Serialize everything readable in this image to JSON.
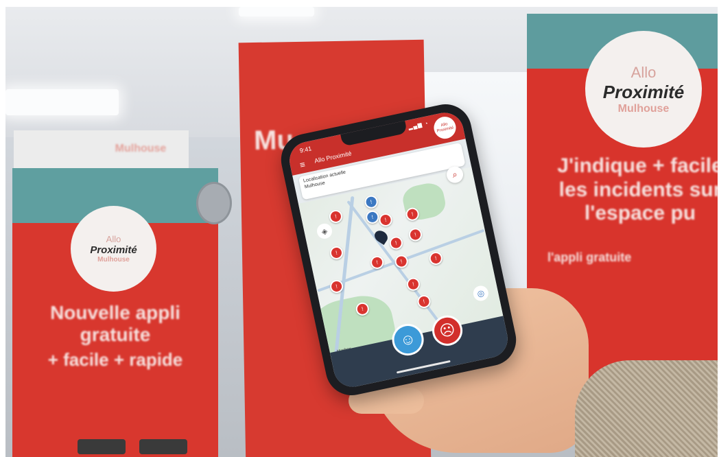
{
  "banners": {
    "right": {
      "logo_line1": "Allo",
      "logo_line2": "Proximité",
      "logo_line3": "Mulhouse",
      "headline": "J'indique + facile les incidents sur l'espace pu",
      "subtext": "l'appli gratuite"
    },
    "left": {
      "logo_line1": "Allo",
      "logo_line2": "Proximité",
      "logo_line3": "Mulhouse",
      "headline": "Nouvelle appli gratuite",
      "tagline": "+ facile + rapide",
      "top_text": "Mulhouse"
    },
    "middle": {
      "headline": "Mu"
    }
  },
  "phone": {
    "status_time": "9:41",
    "status_icons": "▂▄▆ ◔",
    "menu_icon": "hamburger-icon",
    "app_title": "Allo Proximité",
    "logo_badge": "Allo Proximité",
    "address": {
      "line1": "Localisation actuelle",
      "line2": "Mulhouse"
    },
    "map_attribution": "Mapbox",
    "colors": {
      "header": "#c8302b",
      "pin_red": "#d9342f",
      "pin_blue": "#3b78c2",
      "bottom_bar": "#2f3d4e",
      "happy": "#3c9ad8",
      "sad": "#d22f2b"
    }
  }
}
